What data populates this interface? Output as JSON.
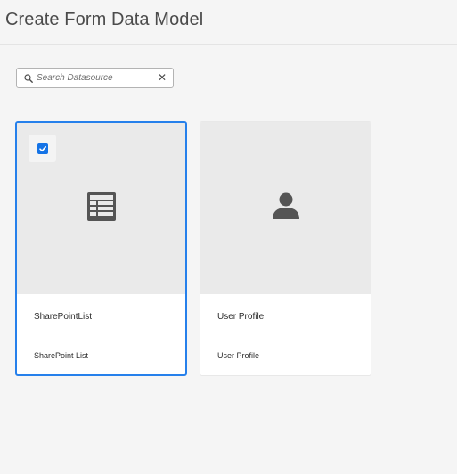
{
  "page": {
    "title": "Create Form Data Model"
  },
  "search": {
    "placeholder": "Search Datasource",
    "value": "",
    "clear_icon": "close-icon"
  },
  "cards": [
    {
      "title": "SharePointList",
      "subtitle": "SharePoint List",
      "icon": "table-icon",
      "selected": true
    },
    {
      "title": "User Profile",
      "subtitle": "User Profile",
      "icon": "user-icon",
      "selected": false
    }
  ],
  "colors": {
    "accent": "#2680eb",
    "checkbox": "#1473e6",
    "icon": "#555555"
  }
}
